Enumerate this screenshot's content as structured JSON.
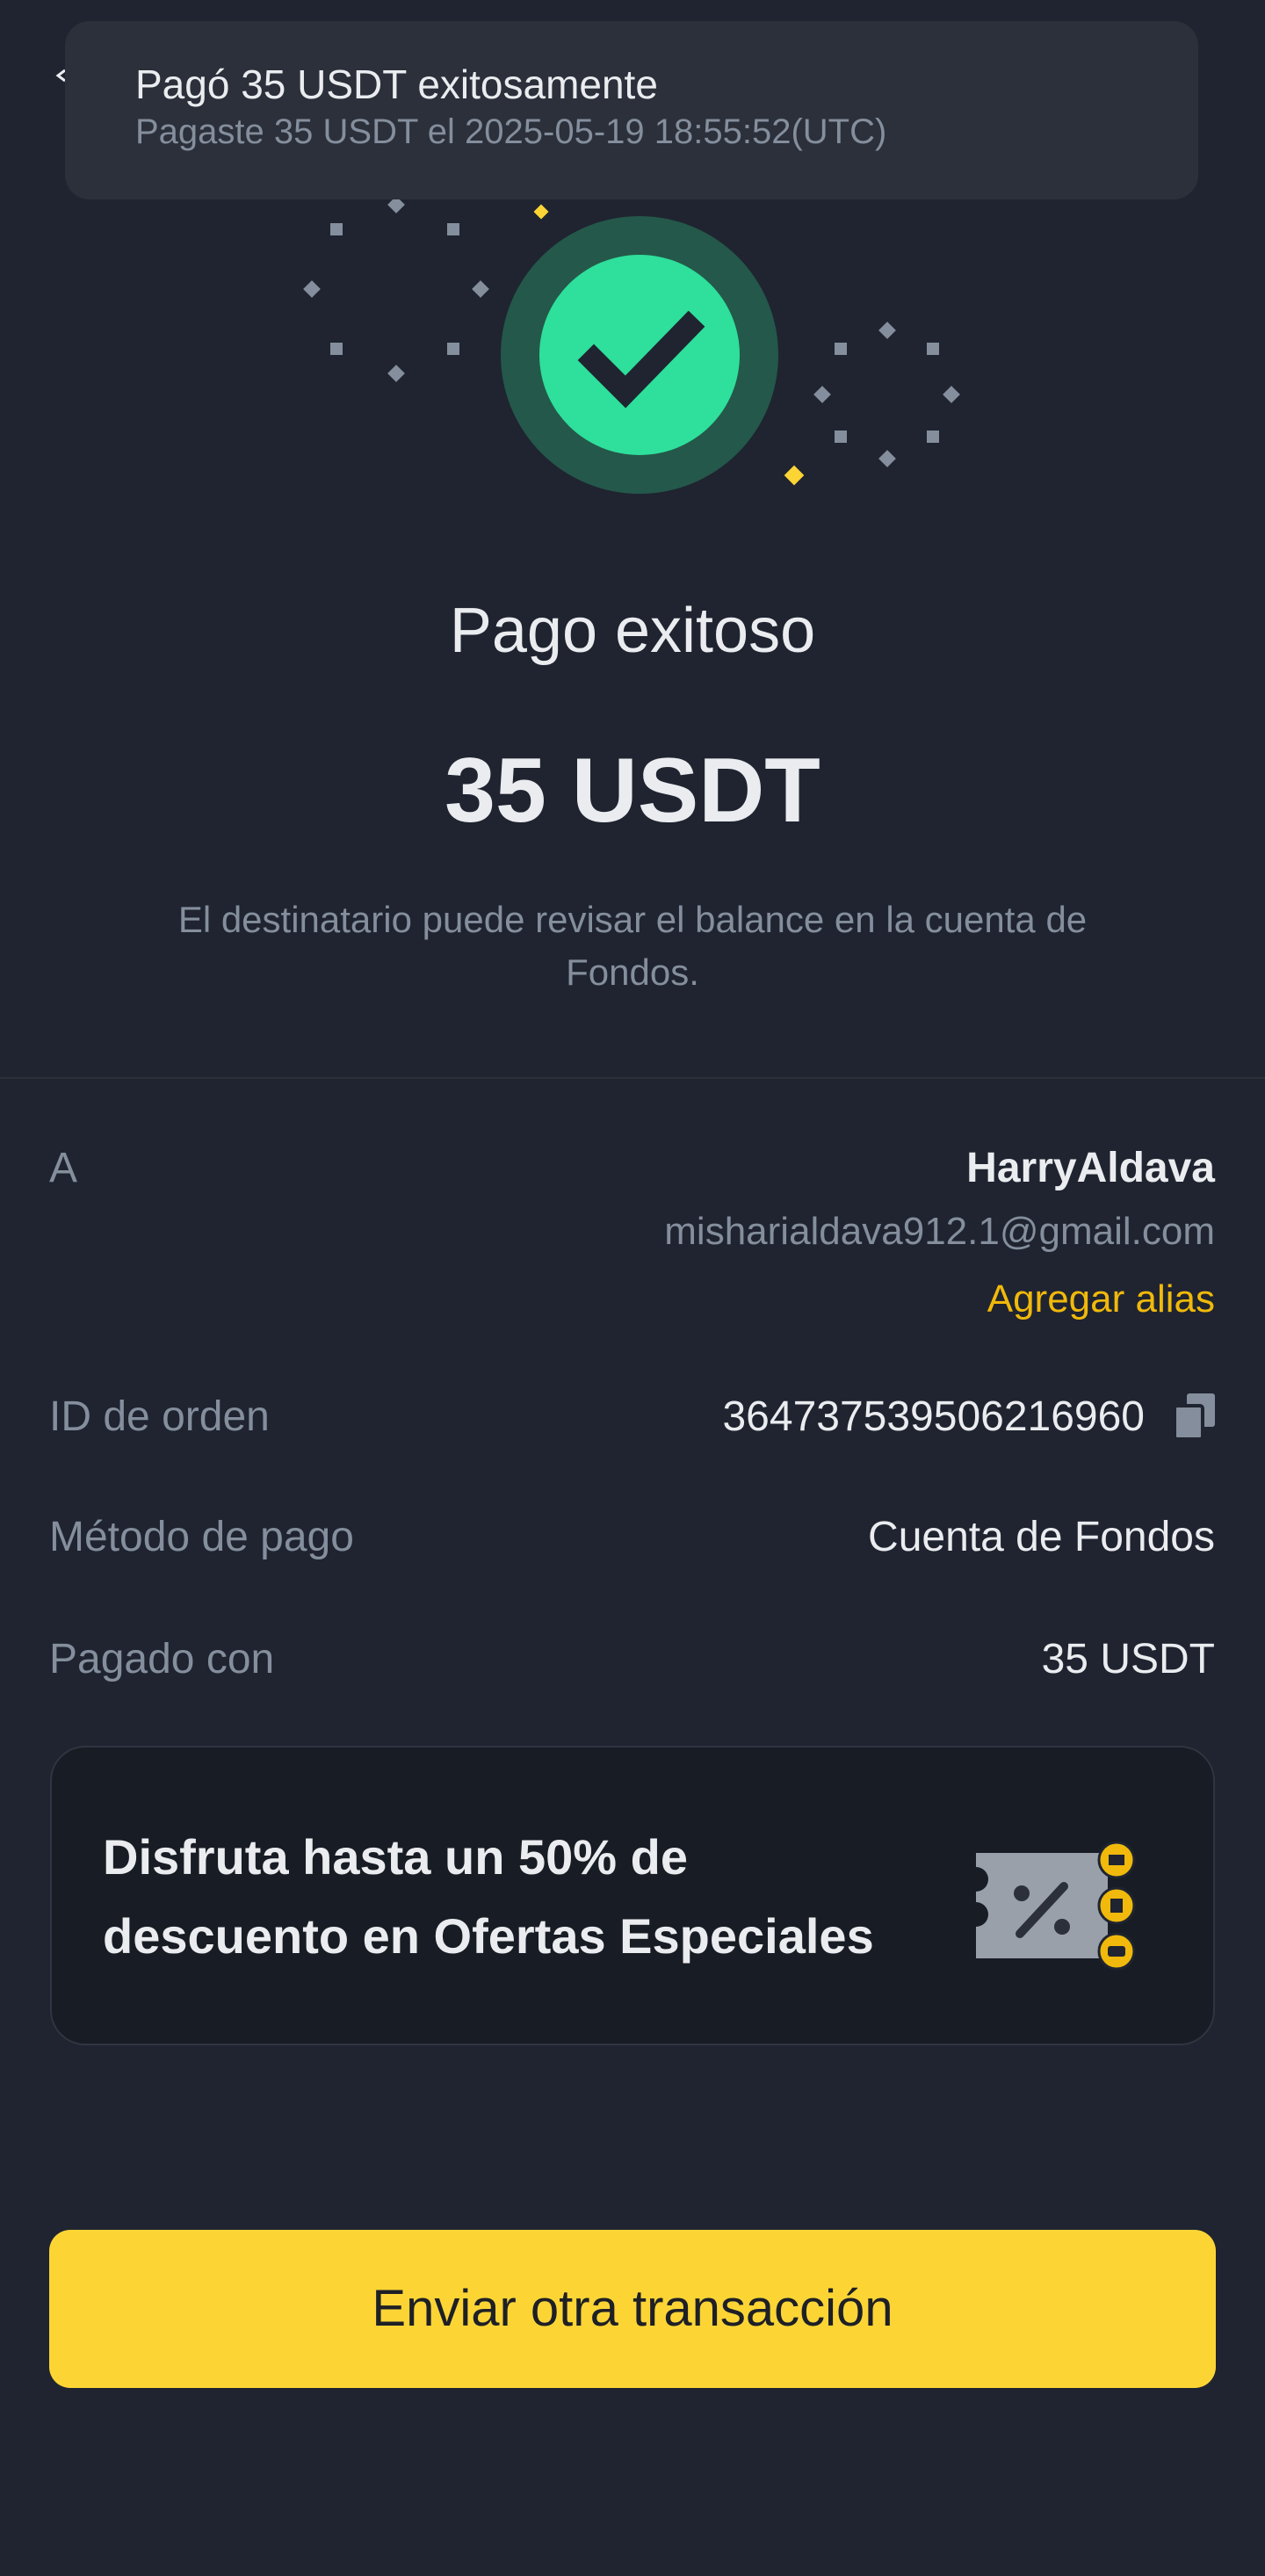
{
  "toast": {
    "title": "Pagó 35 USDT exitosamente",
    "subtitle": "Pagaste 35 USDT el 2025-05-19 18:55:52(UTC)"
  },
  "status": {
    "title": "Pago exitoso",
    "amount": "35 USDT",
    "note": "El destinatario puede revisar el balance en la cuenta de Fondos."
  },
  "details": {
    "recipient_label": "A",
    "recipient_name": "HarryAldava",
    "recipient_email": "misharialdava912.1@gmail.com",
    "add_alias": "Agregar alias",
    "order_id_label": "ID de orden",
    "order_id": "364737539506216960",
    "payment_method_label": "Método de pago",
    "payment_method": "Cuenta de Fondos",
    "paid_with_label": "Pagado con",
    "paid_with": "35 USDT"
  },
  "promo": {
    "text": "Disfruta hasta un 50% de descuento en Ofertas Especiales",
    "icon": "discount-voucher-icon"
  },
  "cta": {
    "label": "Enviar otra transacción"
  },
  "colors": {
    "background": "#1f2430",
    "accent": "#fcd535",
    "success": "#2ee09b",
    "link": "#f0b90b"
  }
}
